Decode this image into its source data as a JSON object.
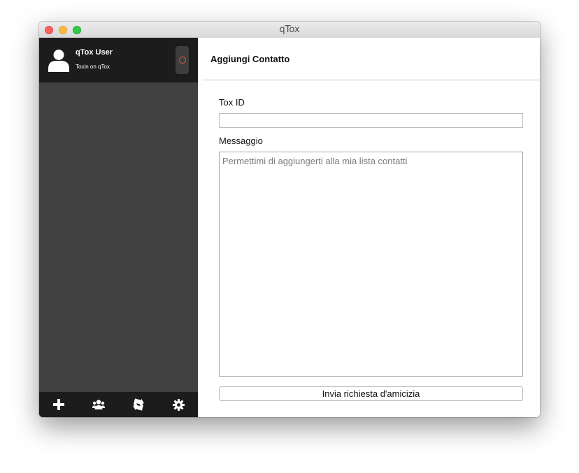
{
  "window": {
    "title": "qTox"
  },
  "profile": {
    "name": "qTox User",
    "status_message": "Toxin on qTox",
    "status_color": "#d05a3d"
  },
  "sidebar": {
    "colors": {
      "profile_bg": "#1c1c1c",
      "list_bg": "#414141"
    },
    "toolbar": [
      {
        "icon": "plus-icon",
        "action": "add-contact"
      },
      {
        "icon": "group-icon",
        "action": "create-group"
      },
      {
        "icon": "transfer-icon",
        "action": "file-transfers"
      },
      {
        "icon": "gear-icon",
        "action": "settings"
      }
    ]
  },
  "main": {
    "title": "Aggiungi Contatto",
    "tox_id_label": "Tox ID",
    "tox_id_value": "",
    "message_label": "Messaggio",
    "message_placeholder": "Permettimi di aggiungerti alla mia lista contatti",
    "send_button": "Invia richiesta d'amicizia"
  }
}
